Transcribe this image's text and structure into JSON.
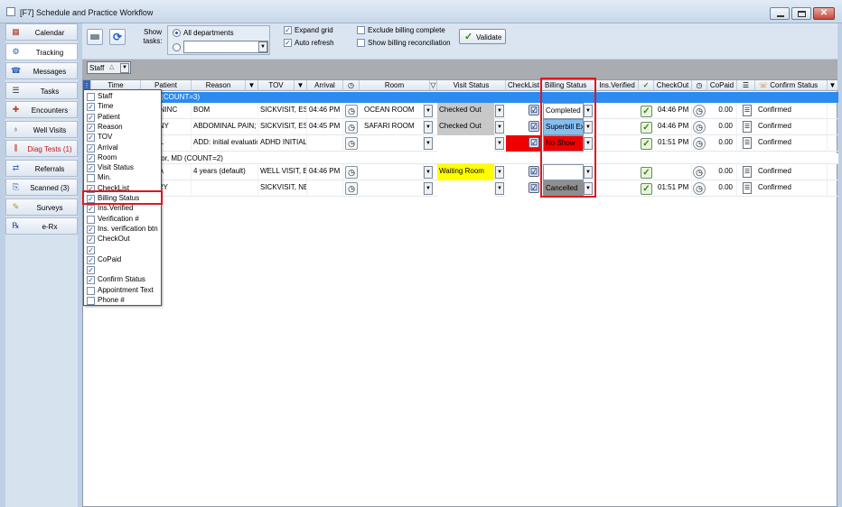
{
  "window": {
    "title": "[F7] Schedule and Practice Workflow"
  },
  "sidebar": {
    "items": [
      {
        "label": "Calendar",
        "icon": "calendar-icon",
        "active": false,
        "color": "#000"
      },
      {
        "label": "Tracking",
        "icon": "tracking-icon",
        "active": true,
        "color": "#000"
      },
      {
        "label": "Messages",
        "icon": "phone-icon",
        "active": false,
        "color": "#000"
      },
      {
        "label": "Tasks",
        "icon": "tasks-icon",
        "active": false,
        "color": "#000"
      },
      {
        "label": "Encounters",
        "icon": "encounters-icon",
        "active": false,
        "color": "#000"
      },
      {
        "label": "Well Visits",
        "icon": "stethoscope-icon",
        "active": false,
        "color": "#000"
      },
      {
        "label": "Diag Tests (1)",
        "icon": "test-tubes-icon",
        "active": false,
        "color": "#c3161c"
      },
      {
        "label": "Referrals",
        "icon": "referrals-icon",
        "active": false,
        "color": "#000"
      },
      {
        "label": "Scanned (3)",
        "icon": "scanned-icon",
        "active": false,
        "color": "#000"
      },
      {
        "label": "Surveys",
        "icon": "surveys-icon",
        "active": false,
        "color": "#000"
      },
      {
        "label": "e-Rx",
        "icon": "rx-icon",
        "active": false,
        "color": "#000"
      }
    ]
  },
  "toolbar": {
    "show_tasks_label": "Show\ntasks:",
    "all_departments": "All departments",
    "expand_grid": "Expand grid",
    "auto_refresh": "Auto refresh",
    "exclude_billing": "Exclude billing complete",
    "show_billing_recon": "Show billing reconciliation",
    "validate": "Validate"
  },
  "groupby": {
    "chip": "Staff"
  },
  "columns": [
    "Time",
    "Patient",
    "Reason",
    "TOV",
    "Arrival",
    "Room",
    "Visit Status",
    "CheckList",
    "Billing Status",
    "Ins.Verified",
    "CheckOut",
    "CoPaid",
    "Confirm Status"
  ],
  "groups": [
    {
      "label": "s  (COUNT=3)",
      "selected": true
    },
    {
      "label": "tor, MD (COUNT=2)",
      "selected": false
    }
  ],
  "rows": [
    {
      "patient": "MORNINC",
      "reason": "BOM",
      "tov": "SICKVISIT, EST",
      "arrival": "04:46 PM",
      "room": "OCEAN ROOM",
      "visit_status": "Checked Out",
      "visit_bg": "#c8c8c8",
      "checklist_bg": "#ffffff",
      "billing": "Completed",
      "billing_bg": "#ffffff",
      "checkout": "04:46 PM",
      "copaid": "0.00",
      "confirm": "Confirmed"
    },
    {
      "patient": "RONNY",
      "reason": "ABDOMINAL PAIN;",
      "tov": "SICKVISIT, EST",
      "arrival": "04:45 PM",
      "room": "SAFARI ROOM",
      "visit_status": "Checked Out",
      "visit_bg": "#c8c8c8",
      "checklist_bg": "#ffffff",
      "billing": "Superbill Exi",
      "billing_bg": "#86bef0",
      "checkout": "04:46 PM",
      "copaid": "0.00",
      "confirm": "Confirmed"
    },
    {
      "patient": "ARIEL",
      "reason": "ADD: initial evaluation",
      "tov": "ADHD INITIAL",
      "arrival": "",
      "room": "",
      "visit_status": "",
      "visit_bg": "#ffffff",
      "checklist_bg": "#f00000",
      "billing": "No Show",
      "billing_bg": "#f00000",
      "checkout": "01:51 PM",
      "copaid": "0.00",
      "confirm": "Confirmed"
    },
    {
      "patient": "ANITA",
      "reason": "4 years (default)",
      "tov": "WELL VISIT, EST",
      "arrival": "04:46 PM",
      "room": "",
      "visit_status": "Waiting Room",
      "visit_bg": "#ffff00",
      "checklist_bg": "#ffffff",
      "billing": "",
      "billing_bg": "#ffffff",
      "checkout": "",
      "copaid": "0.00",
      "confirm": "Confirmed"
    },
    {
      "patient": "HENRY",
      "reason": "",
      "tov": "SICKVISIT, NEW",
      "arrival": "",
      "room": "",
      "visit_status": "",
      "visit_bg": "#ffffff",
      "checklist_bg": "#ffffff",
      "billing": "Cancelled",
      "billing_bg": "#8e8e8e",
      "checkout": "01:51 PM",
      "copaid": "0.00",
      "confirm": "Confirmed"
    }
  ],
  "column_chooser": {
    "items": [
      {
        "label": "Staff",
        "checked": false
      },
      {
        "label": "Time",
        "checked": true
      },
      {
        "label": "Patient",
        "checked": true
      },
      {
        "label": "Reason",
        "checked": true
      },
      {
        "label": "TOV",
        "checked": true
      },
      {
        "label": "Arrival",
        "checked": true
      },
      {
        "label": "Room",
        "checked": true
      },
      {
        "label": "Visit Status",
        "checked": true
      },
      {
        "label": "Min.",
        "checked": false
      },
      {
        "label": "CheckList",
        "checked": true
      },
      {
        "label": "Billing Status",
        "checked": true,
        "highlight": true
      },
      {
        "label": "Ins.Verified",
        "checked": true
      },
      {
        "label": "Verification #",
        "checked": false
      },
      {
        "label": "Ins. verification btn",
        "checked": true
      },
      {
        "label": "CheckOut",
        "checked": true
      },
      {
        "label": "",
        "checked": true
      },
      {
        "label": "CoPaid",
        "checked": true
      },
      {
        "label": "",
        "checked": true
      },
      {
        "label": "Confirm Status",
        "checked": true
      },
      {
        "label": "Appointment Text",
        "checked": false
      },
      {
        "label": "Phone #",
        "checked": false
      }
    ]
  }
}
